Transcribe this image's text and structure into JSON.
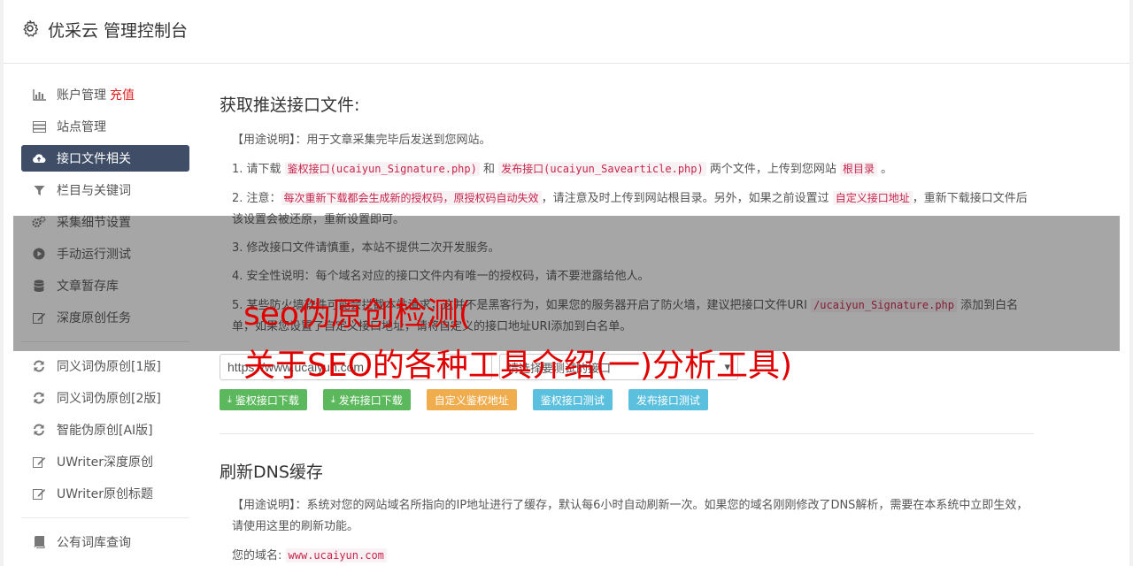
{
  "header": {
    "title": "优采云 管理控制台"
  },
  "sidebar": {
    "items": [
      {
        "label": "账户管理",
        "extra": "充值",
        "icon": "bar-chart-icon"
      },
      {
        "label": "站点管理",
        "icon": "server-icon"
      },
      {
        "label": "接口文件相关",
        "icon": "cloud-upload-icon",
        "active": true
      },
      {
        "label": "栏目与关键词",
        "icon": "filter-icon"
      },
      {
        "label": "采集细节设置",
        "icon": "cogs-icon"
      },
      {
        "label": "手动运行测试",
        "icon": "play-icon"
      },
      {
        "label": "文章暂存库",
        "icon": "database-icon"
      },
      {
        "label": "深度原创任务",
        "icon": "edit-icon"
      }
    ],
    "items2": [
      {
        "label": "同义词伪原创[1版]",
        "icon": "refresh-icon"
      },
      {
        "label": "同义词伪原创[2版]",
        "icon": "refresh-icon"
      },
      {
        "label": "智能伪原创[AI版]",
        "icon": "refresh-icon"
      },
      {
        "label": "UWriter深度原创",
        "icon": "edit-icon"
      },
      {
        "label": "UWriter原创标题",
        "icon": "edit-icon"
      }
    ],
    "items3": [
      {
        "label": "公有词库查询",
        "icon": "book-icon"
      }
    ]
  },
  "section1": {
    "title": "获取推送接口文件:",
    "usage": "【用途说明】：用于文章采集完毕后发送到您网站。",
    "p1": {
      "a": "1. 请下载 ",
      "code1": "鉴权接口(ucaiyun_Signature.php)",
      "b": " 和 ",
      "code2": "发布接口(ucaiyun_Savearticle.php)",
      "c": " 两个文件，上传到您网站 ",
      "code3": "根目录",
      "d": " 。"
    },
    "p2": {
      "a": "2. 注意：",
      "code1": "每次重新下载都会生成新的授权码，原授权码自动失效",
      "b": "，请注意及时上传到网站根目录。另外，如果之前设置过 ",
      "code2": "自定义接口地址",
      "c": "，重新下载接口文件后该设置会被还原，重新设置即可。"
    },
    "p3": "3. 修改接口文件请慎重，本站不提供二次开发服务。",
    "p4": "4. 安全性说明：每个域名对应的接口文件内有唯一的授权码，请不要泄露给他人。",
    "p5": {
      "a": "5. 某些防火墙软件可能会拦截本站请求，这并不是黑客行为，如果您的服务器开启了防火墙，建议把接口文件URI ",
      "code1": "/ucaiyun_Signature.php",
      "b": " 添加到白名单，如果您设置了自定义接口地址，请将自定义的接口地址URI添加到白名单。"
    },
    "url_value": "https://www.ucaiyun.com",
    "select_placeholder": "请选择要测试的接口",
    "buttons": [
      {
        "label": "鉴权接口下载",
        "color": "green",
        "icon": "download-icon"
      },
      {
        "label": "发布接口下载",
        "color": "green",
        "icon": "download-icon"
      },
      {
        "label": "自定义鉴权地址",
        "color": "orange"
      },
      {
        "label": "鉴权接口测试",
        "color": "blue"
      },
      {
        "label": "发布接口测试",
        "color": "blue"
      }
    ]
  },
  "section2": {
    "title": "刷新DNS缓存",
    "usage": "【用途说明】：系统对您的网站域名所指向的IP地址进行了缓存，默认每6小时自动刷新一次。如果您的域名刚刚修改了DNS解析，需要在本系统中立即生效，请使用这里的刷新功能。",
    "domain_label": "您的域名:",
    "domain_value": "www.ucaiyun.com"
  },
  "overlay": {
    "line1": "seo伪原创检测(",
    "line2": "关于SEO的各种工具介绍(一)分析工具)"
  }
}
